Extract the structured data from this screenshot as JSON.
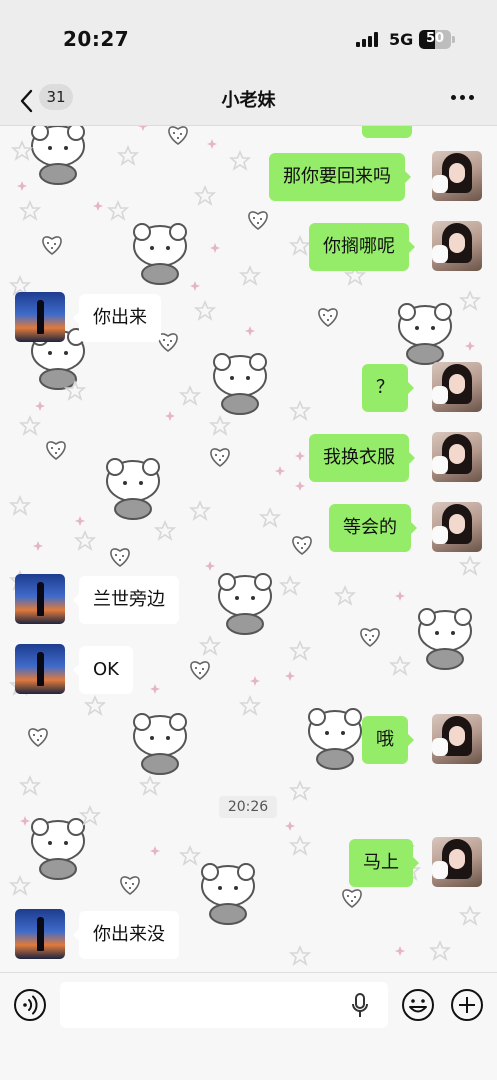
{
  "status_bar": {
    "time": "20:27",
    "network": "5G",
    "battery": "50"
  },
  "nav": {
    "unread_count": "31",
    "title": "小老妹"
  },
  "messages": [
    {
      "side": "right",
      "text": "那你要回来吗"
    },
    {
      "side": "right",
      "text": "你搁哪呢"
    },
    {
      "side": "left",
      "text": "你出来"
    },
    {
      "side": "right",
      "text": "？"
    },
    {
      "side": "right",
      "text": "我换衣服"
    },
    {
      "side": "right",
      "text": "等会的"
    },
    {
      "side": "left",
      "text": "兰世旁边"
    },
    {
      "side": "left",
      "text": "OK"
    },
    {
      "side": "right",
      "text": "哦"
    },
    {
      "side": "right",
      "text": "马上"
    },
    {
      "side": "left",
      "text": "你出来没"
    }
  ],
  "timestamp": "20:26",
  "colors": {
    "bubble_mine": "#95ec69",
    "bubble_theirs": "#ffffff",
    "background": "#f7f7f7"
  },
  "icons": [
    "chevron-left-icon",
    "more-icon",
    "voice-icon",
    "microphone-icon",
    "emoji-icon",
    "plus-icon"
  ]
}
